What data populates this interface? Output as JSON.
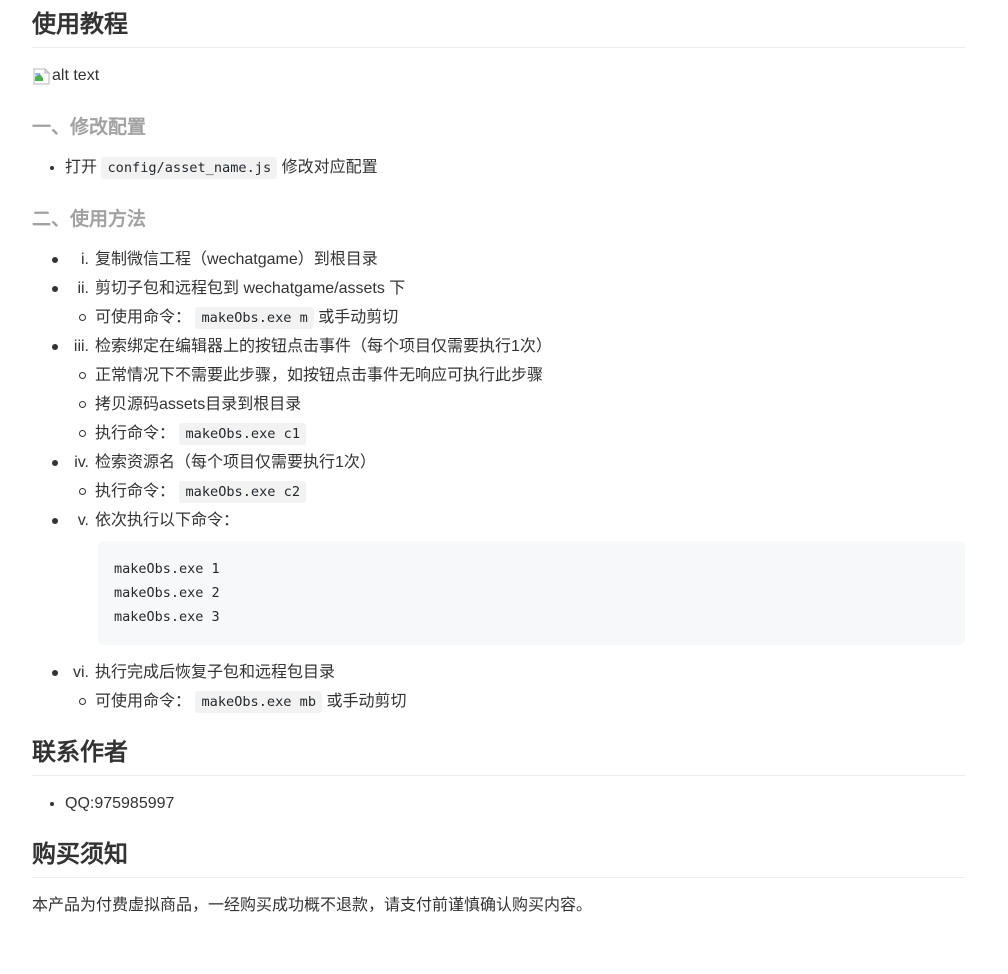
{
  "colors": {
    "heading": "#333333",
    "muted_heading": "#a2a2a2",
    "divider": "#eaecef",
    "inline_code_bg": "#f0f1f2",
    "code_block_bg": "#f6f8fa",
    "code_text": "#24292e"
  },
  "doc": {
    "title": "使用教程",
    "image_alt": "alt text"
  },
  "config_section": {
    "heading": "一、修改配置",
    "item": {
      "pre": "打开 ",
      "code": "config/asset_name.js",
      "post": " 修改对应配置"
    }
  },
  "usage_section": {
    "heading": "二、使用方法",
    "steps": [
      {
        "marker": "i.",
        "text": "复制微信工程（wechatgame）到根目录"
      },
      {
        "marker": "ii.",
        "text": "剪切子包和远程包到 wechatgame/assets 下",
        "subs": [
          {
            "pre": "可使用命令： ",
            "code": "makeObs.exe m",
            "post": " 或手动剪切"
          }
        ]
      },
      {
        "marker": "iii.",
        "text": "检索绑定在编辑器上的按钮点击事件（每个项目仅需要执行1次）",
        "subs": [
          {
            "pre": "正常情况下不需要此步骤，如按钮点击事件无响应可执行此步骤"
          },
          {
            "pre": "拷贝源码assets目录到根目录"
          },
          {
            "pre": "执行命令： ",
            "code": "makeObs.exe c1"
          }
        ]
      },
      {
        "marker": "iv.",
        "text": "检索资源名（每个项目仅需要执行1次）",
        "subs": [
          {
            "pre": "执行命令： ",
            "code": "makeObs.exe c2"
          }
        ]
      },
      {
        "marker": "v.",
        "text": "依次执行以下命令：",
        "code_block": "makeObs.exe 1\nmakeObs.exe 2\nmakeObs.exe 3"
      },
      {
        "marker": "vi.",
        "text": "执行完成后恢复子包和远程包目录",
        "subs": [
          {
            "pre": "可使用命令： ",
            "code": "makeObs.exe mb",
            "post": " 或手动剪切"
          }
        ]
      }
    ]
  },
  "contact_section": {
    "heading": "联系作者",
    "item": "QQ:975985997"
  },
  "purchase_section": {
    "heading": "购买须知",
    "text": "本产品为付费虚拟商品，一经购买成功概不退款，请支付前谨慎确认购买内容。"
  }
}
